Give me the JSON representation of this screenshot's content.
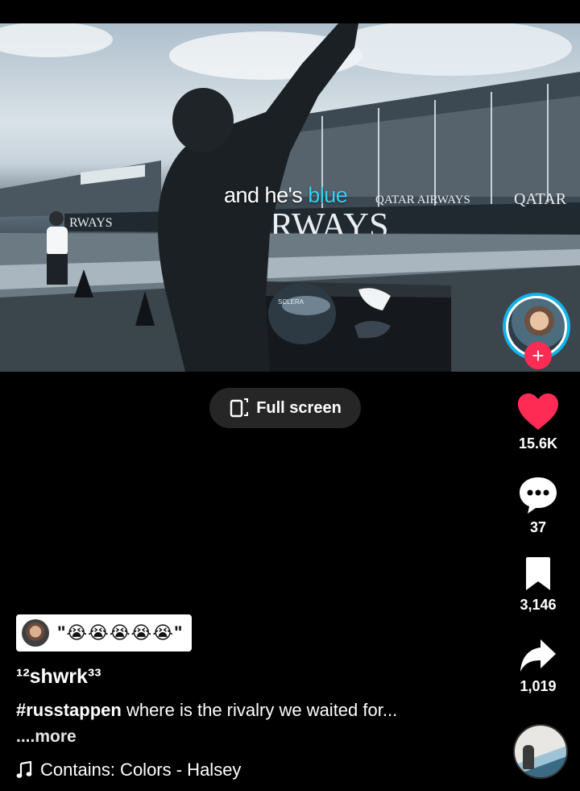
{
  "video": {
    "caption_prefix": "and he's ",
    "caption_highlight": "blue",
    "banner_text_large": "RWAYS",
    "banner_text_small_1": "QATAR AIRWAYS",
    "banner_text_small_2": "QATAR",
    "banner_text_left": "RWAYS",
    "helmet_text": "SCLERA"
  },
  "fullscreen": {
    "label": "Full screen",
    "icon": "fullscreen-icon"
  },
  "actions": {
    "likes": "15.6K",
    "comments": "37",
    "saves": "3,146",
    "shares": "1,019",
    "like_color": "#fe2c55"
  },
  "follow": {
    "label": "+"
  },
  "sticker": {
    "text": "\"😭😭😭😭😭\""
  },
  "post": {
    "username": "¹²shwrk³³",
    "hashtag": "#russtappen",
    "description": " where is the rivalry we waited for...",
    "more": "....more",
    "sound": "Contains: Colors - Halsey"
  },
  "colors": {
    "accent": "#fe2c55",
    "avatar_ring": "#12b3e8",
    "caption_highlight": "#38d0f0"
  }
}
